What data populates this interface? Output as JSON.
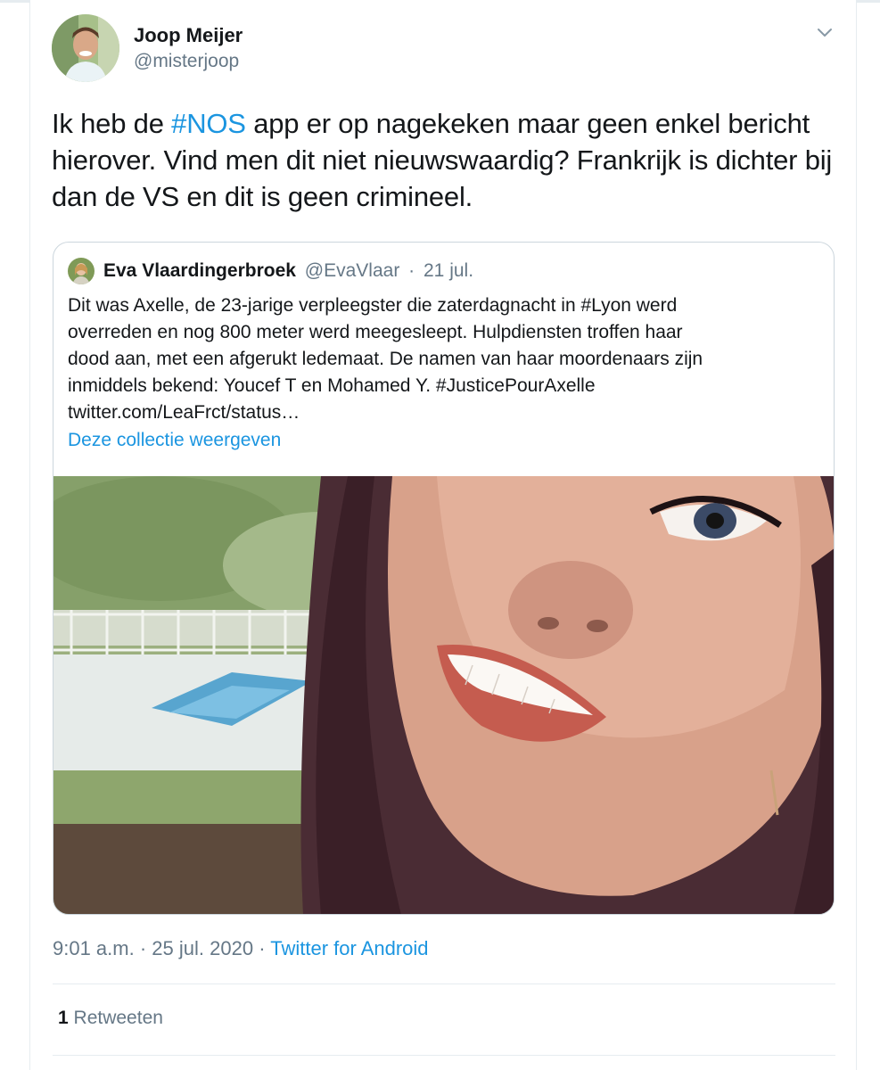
{
  "author": {
    "name": "Joop Meijer",
    "handle": "@misterjoop",
    "avatar_icon": "profile-photo"
  },
  "tweet": {
    "text_parts": [
      "Ik heb de ",
      "#NOS",
      " app er op nagekeken maar geen enkel bericht hierover. Vind men dit niet nieuwswaardig? Frankrijk is dichter bij dan de VS en dit is geen crimineel."
    ]
  },
  "quoted_tweet": {
    "name": "Eva Vlaardingerbroek",
    "handle": "@EvaVlaar",
    "separator": "·",
    "date": "21 jul.",
    "body": "Dit was Axelle, de 23-jarige verpleegster die zaterdagnacht in #Lyon werd\noverreden en nog 800 meter werd meegesleept. Hulpdiensten troffen haar\ndood aan, met een afgerukt ledemaat. De namen van haar moordenaars zijn\ninmiddels bekend: Youcef T en Mohamed Y. #JusticePourAxelle\ntwitter.com/LeaFrct/status…",
    "collection_link": "Deze collectie weergeven",
    "media": "photo"
  },
  "meta": {
    "time": "9:01 a.m.",
    "dot": "·",
    "date": "25 jul. 2020",
    "source": "Twitter for Android"
  },
  "stats": {
    "retweet_count": "1",
    "retweet_label": "Retweeten"
  },
  "colors": {
    "link": "#1b95e0",
    "secondary_text": "#657786",
    "border": "#ccd6dd"
  }
}
